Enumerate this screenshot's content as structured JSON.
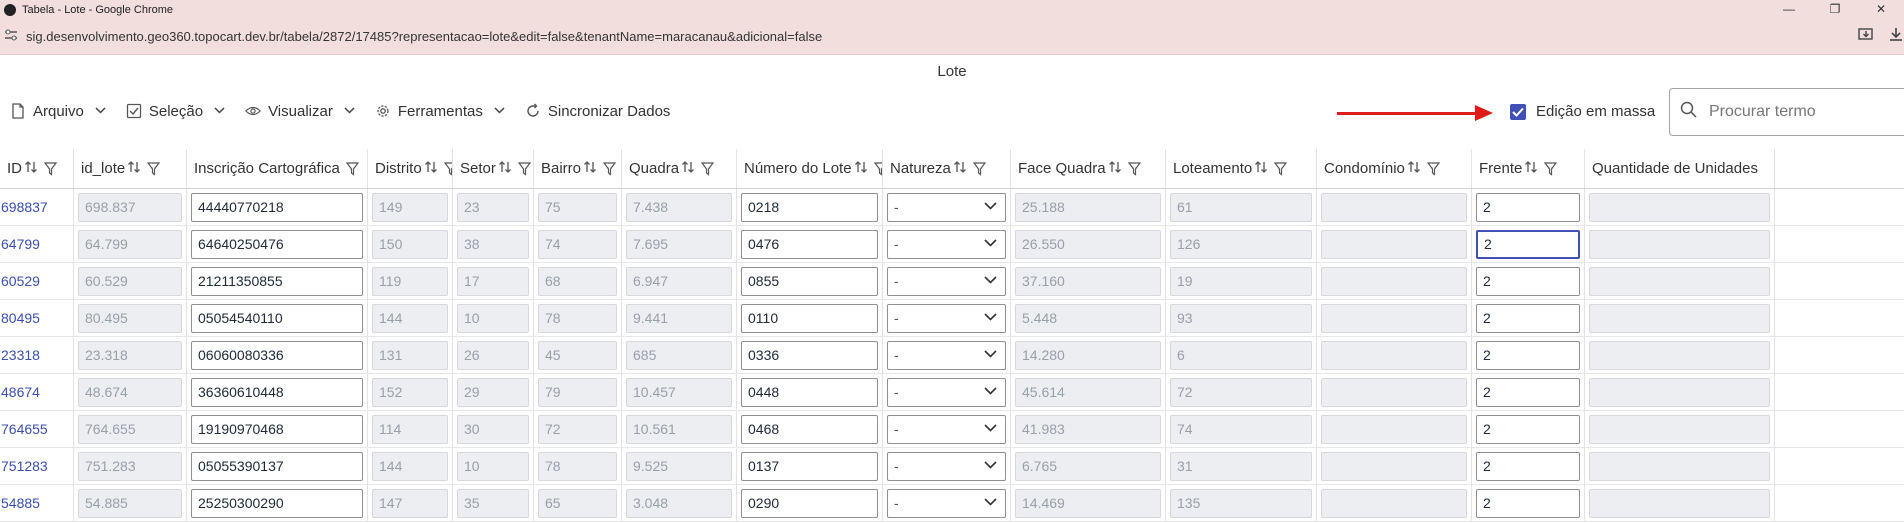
{
  "window": {
    "title": "Tabela - Lote - Google Chrome",
    "minimize": "—",
    "restore": "❐",
    "close": "✕"
  },
  "browser": {
    "url": "sig.desenvolvimento.geo360.topocart.dev.br/tabela/2872/17485?representacao=lote&edit=false&tenantName=maracanau&adicional=false"
  },
  "page": {
    "title": "Lote"
  },
  "toolbar": {
    "menus": [
      {
        "label": "Arquivo",
        "icon": "file-icon"
      },
      {
        "label": "Seleção",
        "icon": "checkbox-icon"
      },
      {
        "label": "Visualizar",
        "icon": "eye-icon"
      },
      {
        "label": "Ferramentas",
        "icon": "gear-icon"
      }
    ],
    "sync_label": "Sincronizar Dados",
    "mass_edit_label": "Edição em massa",
    "mass_edit_checked": true,
    "search_placeholder": "Procurar termo"
  },
  "annotation": {
    "arrow_color": "#e01b1b"
  },
  "colors": {
    "accent": "#3f51b5",
    "link": "#3b4fb0"
  },
  "table": {
    "columns": [
      "ID",
      "id_lote",
      "Inscrição Cartográfica",
      "Distrito",
      "Setor",
      "Bairro",
      "Quadra",
      "Número do Lote",
      "Natureza",
      "Face Quadra",
      "Loteamento",
      "Condomínio",
      "Frente",
      "Quantidade de Unidades"
    ],
    "rows": [
      {
        "id": "698837",
        "id_lote": "698.837",
        "inscricao": "44440770218",
        "distrito": "149",
        "setor": "23",
        "bairro": "75",
        "quadra": "7.438",
        "numero_lote": "0218",
        "natureza": "-",
        "face_quadra": "25.188",
        "loteamento": "61",
        "condominio": "",
        "frente": "2",
        "quantidade": ""
      },
      {
        "id": "64799",
        "id_lote": "64.799",
        "inscricao": "64640250476",
        "distrito": "150",
        "setor": "38",
        "bairro": "74",
        "quadra": "7.695",
        "numero_lote": "0476",
        "natureza": "-",
        "face_quadra": "26.550",
        "loteamento": "126",
        "condominio": "",
        "frente": "2",
        "quantidade": ""
      },
      {
        "id": "60529",
        "id_lote": "60.529",
        "inscricao": "21211350855",
        "distrito": "119",
        "setor": "17",
        "bairro": "68",
        "quadra": "6.947",
        "numero_lote": "0855",
        "natureza": "-",
        "face_quadra": "37.160",
        "loteamento": "19",
        "condominio": "",
        "frente": "2",
        "quantidade": ""
      },
      {
        "id": "80495",
        "id_lote": "80.495",
        "inscricao": "05054540110",
        "distrito": "144",
        "setor": "10",
        "bairro": "78",
        "quadra": "9.441",
        "numero_lote": "0110",
        "natureza": "-",
        "face_quadra": "5.448",
        "loteamento": "93",
        "condominio": "",
        "frente": "2",
        "quantidade": ""
      },
      {
        "id": "23318",
        "id_lote": "23.318",
        "inscricao": "06060080336",
        "distrito": "131",
        "setor": "26",
        "bairro": "45",
        "quadra": "685",
        "numero_lote": "0336",
        "natureza": "-",
        "face_quadra": "14.280",
        "loteamento": "6",
        "condominio": "",
        "frente": "2",
        "quantidade": ""
      },
      {
        "id": "48674",
        "id_lote": "48.674",
        "inscricao": "36360610448",
        "distrito": "152",
        "setor": "29",
        "bairro": "79",
        "quadra": "10.457",
        "numero_lote": "0448",
        "natureza": "-",
        "face_quadra": "45.614",
        "loteamento": "72",
        "condominio": "",
        "frente": "2",
        "quantidade": ""
      },
      {
        "id": "764655",
        "id_lote": "764.655",
        "inscricao": "19190970468",
        "distrito": "114",
        "setor": "30",
        "bairro": "72",
        "quadra": "10.561",
        "numero_lote": "0468",
        "natureza": "-",
        "face_quadra": "41.983",
        "loteamento": "74",
        "condominio": "",
        "frente": "2",
        "quantidade": ""
      },
      {
        "id": "751283",
        "id_lote": "751.283",
        "inscricao": "05055390137",
        "distrito": "144",
        "setor": "10",
        "bairro": "78",
        "quadra": "9.525",
        "numero_lote": "0137",
        "natureza": "-",
        "face_quadra": "6.765",
        "loteamento": "31",
        "condominio": "",
        "frente": "2",
        "quantidade": ""
      },
      {
        "id": "54885",
        "id_lote": "54.885",
        "inscricao": "25250300290",
        "distrito": "147",
        "setor": "35",
        "bairro": "65",
        "quadra": "3.048",
        "numero_lote": "0290",
        "natureza": "-",
        "face_quadra": "14.469",
        "loteamento": "135",
        "condominio": "",
        "frente": "2",
        "quantidade": ""
      }
    ]
  }
}
